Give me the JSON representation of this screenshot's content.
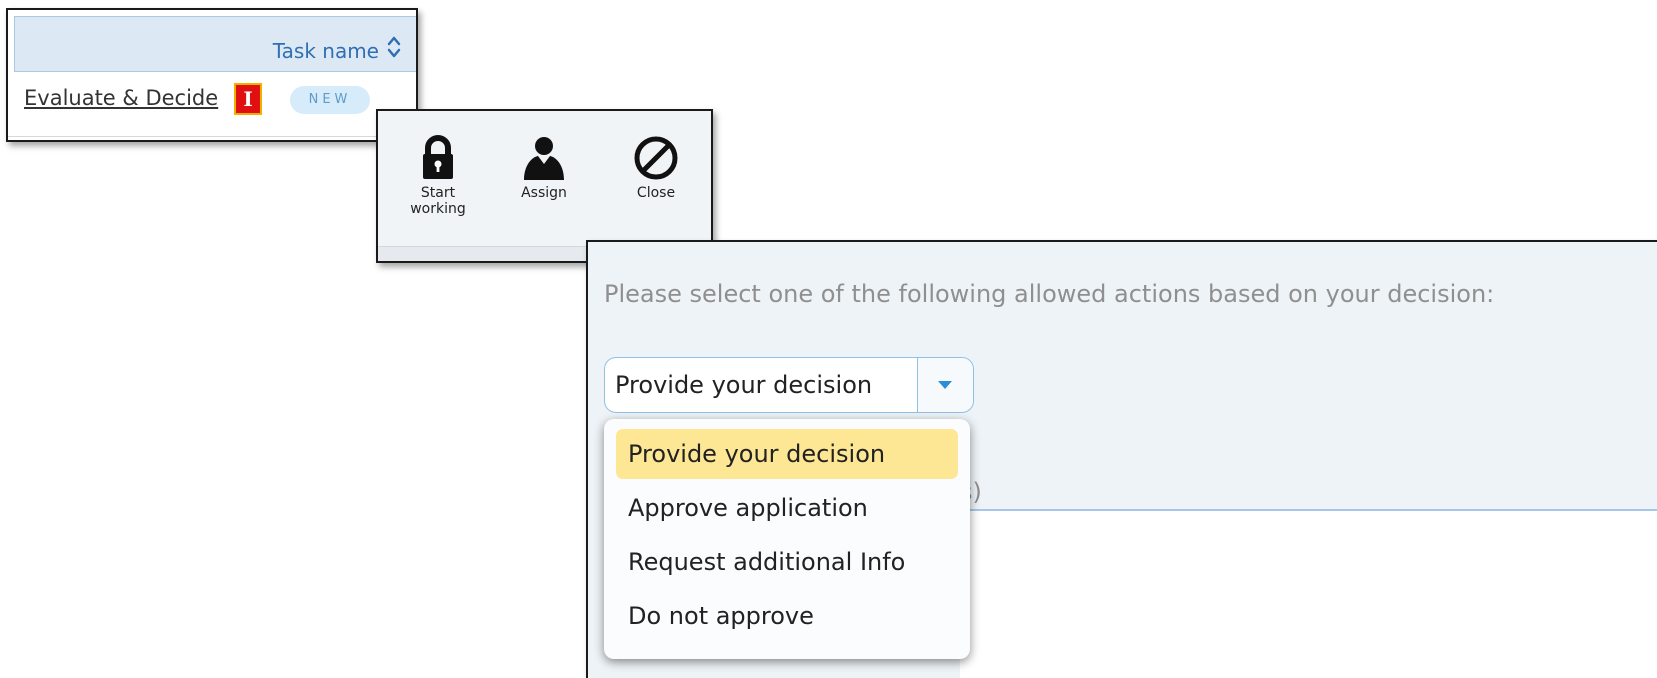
{
  "task_list": {
    "column_header": "Task name",
    "row": {
      "task_link": "Evaluate & Decide",
      "marker": "I",
      "status_badge": "NEW"
    }
  },
  "action_toolbar": {
    "buttons": [
      {
        "label": "Start working",
        "icon": "lock-icon"
      },
      {
        "label": "Assign",
        "icon": "user-icon"
      },
      {
        "label": "Close",
        "icon": "prohibited-icon"
      }
    ]
  },
  "decision_form": {
    "prompt": "Please select one of the following allowed actions based on your decision:",
    "select_value": "Provide your decision",
    "partial_hidden_text": "s)",
    "options": [
      {
        "label": "Provide your decision",
        "selected": true
      },
      {
        "label": "Approve application",
        "selected": false
      },
      {
        "label": "Request additional Info",
        "selected": false
      },
      {
        "label": "Do not approve",
        "selected": false
      }
    ]
  },
  "colors": {
    "header_bg": "#dce9f5",
    "accent_blue": "#2f6fb2",
    "marker_red": "#e01010",
    "badge_bg": "#d6ecfa",
    "selected_option_bg": "#fde694",
    "prompt_gray": "#8f8f8f"
  }
}
